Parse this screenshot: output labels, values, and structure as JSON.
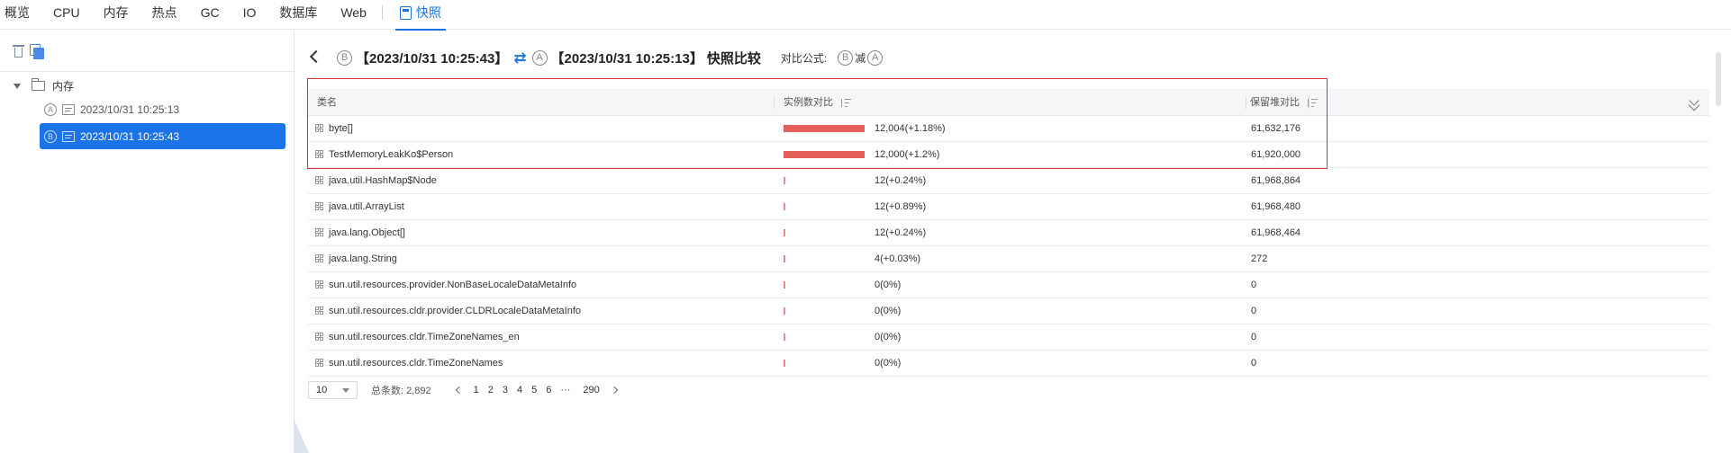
{
  "tabs": [
    {
      "label": "概览"
    },
    {
      "label": "CPU"
    },
    {
      "label": "内存"
    },
    {
      "label": "热点"
    },
    {
      "label": "GC"
    },
    {
      "label": "IO"
    },
    {
      "label": "数据库"
    },
    {
      "label": "Web"
    }
  ],
  "active_tab": {
    "label": "快照",
    "icon": "snapshot-icon"
  },
  "accent_color": "#1a73e8",
  "bar_color": "#e5605a",
  "tree": {
    "root_label": "内存",
    "items": [
      {
        "badge": "A",
        "label": "2023/10/31 10:25:13",
        "selected": false
      },
      {
        "badge": "B",
        "label": "2023/10/31 10:25:43",
        "selected": true
      }
    ]
  },
  "header": {
    "badge_b": "B",
    "left_time": "【2023/10/31 10:25:43】",
    "swap_icon": "⇄",
    "badge_a": "A",
    "right_time": "【2023/10/31 10:25:13】",
    "title_suffix": "快照比较",
    "formula_label": "对比公式:",
    "formula_b": "B",
    "formula_minus": "减",
    "formula_a": "A"
  },
  "table": {
    "columns": {
      "name": "类名",
      "instances": "实例数对比",
      "retained": "保留堆对比"
    },
    "rows": [
      {
        "name": "byte[]",
        "instances": "12,004(+1.18%)",
        "retained": "61,632,176",
        "bar": 12004
      },
      {
        "name": "TestMemoryLeakKo$Person",
        "instances": "12,000(+1.2%)",
        "retained": "61,920,000",
        "bar": 12000
      },
      {
        "name": "java.util.HashMap$Node",
        "instances": "12(+0.24%)",
        "retained": "61,968,864",
        "bar": 12
      },
      {
        "name": "java.util.ArrayList",
        "instances": "12(+0.89%)",
        "retained": "61,968,480",
        "bar": 12
      },
      {
        "name": "java.lang.Object[]",
        "instances": "12(+0.24%)",
        "retained": "61,968,464",
        "bar": 12
      },
      {
        "name": "java.lang.String",
        "instances": "4(+0.03%)",
        "retained": "272",
        "bar": 4
      },
      {
        "name": "sun.util.resources.provider.NonBaseLocaleDataMetaInfo",
        "instances": "0(0%)",
        "retained": "0",
        "bar": 0
      },
      {
        "name": "sun.util.resources.cldr.provider.CLDRLocaleDataMetaInfo",
        "instances": "0(0%)",
        "retained": "0",
        "bar": 0
      },
      {
        "name": "sun.util.resources.cldr.TimeZoneNames_en",
        "instances": "0(0%)",
        "retained": "0",
        "bar": 0
      },
      {
        "name": "sun.util.resources.cldr.TimeZoneNames",
        "instances": "0(0%)",
        "retained": "0",
        "bar": 0
      }
    ]
  },
  "pagination": {
    "page_size": "10",
    "total": "总条数: 2,892",
    "pages": [
      "1",
      "2",
      "3",
      "4",
      "5",
      "6",
      "···",
      "290"
    ]
  }
}
